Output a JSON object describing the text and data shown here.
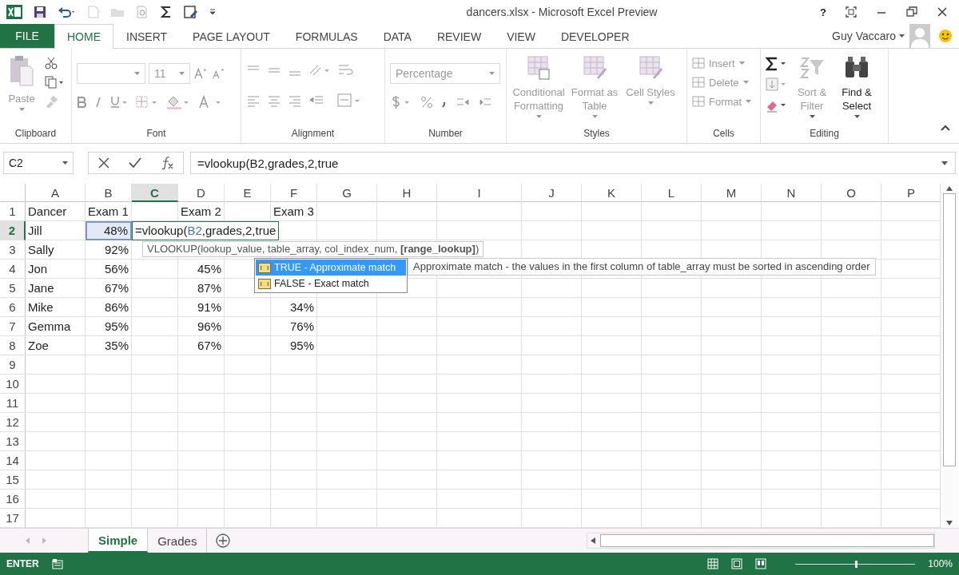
{
  "window": {
    "title": "dancers.xlsx - Microsoft Excel Preview",
    "controls": [
      "?"
    ]
  },
  "tabs": [
    {
      "label": "FILE",
      "kind": "file",
      "selected": false
    },
    {
      "label": "HOME",
      "kind": "tab",
      "selected": true
    },
    {
      "label": "INSERT",
      "kind": "tab",
      "selected": false
    },
    {
      "label": "PAGE LAYOUT",
      "kind": "tab",
      "selected": false
    },
    {
      "label": "FORMULAS",
      "kind": "tab",
      "selected": false
    },
    {
      "label": "DATA",
      "kind": "tab",
      "selected": false
    },
    {
      "label": "REVIEW",
      "kind": "tab",
      "selected": false
    },
    {
      "label": "VIEW",
      "kind": "tab",
      "selected": false
    },
    {
      "label": "DEVELOPER",
      "kind": "tab",
      "selected": false
    }
  ],
  "user": {
    "name": "Guy Vaccaro"
  },
  "ribbon": [
    {
      "kind": "clipboard",
      "label": "Clipboard",
      "items": [
        {
          "label": "Paste",
          "disabled": true
        }
      ]
    },
    {
      "kind": "font",
      "label": "Font",
      "items": [
        {
          "label": "11",
          "disabled": true
        }
      ]
    },
    {
      "kind": "alignment",
      "label": "Alignment"
    },
    {
      "kind": "number",
      "label": "Number",
      "items": [
        {
          "label": "Percentage",
          "disabled": true
        }
      ]
    },
    {
      "kind": "styles",
      "label": "Styles",
      "items": [
        {
          "label": "Conditional Formatting",
          "disabled": true
        },
        {
          "label": "Format as Table",
          "disabled": true
        },
        {
          "label": "Cell Styles",
          "disabled": true
        }
      ]
    },
    {
      "kind": "cells",
      "label": "Cells",
      "items": [
        {
          "label": "Insert",
          "disabled": true
        },
        {
          "label": "Delete",
          "disabled": true
        },
        {
          "label": "Format",
          "disabled": true
        }
      ]
    },
    {
      "kind": "editing",
      "label": "Editing",
      "items": [
        {
          "label": "Sort & Filter",
          "disabled": true
        },
        {
          "label": "Find & Select",
          "disabled": false
        }
      ]
    }
  ],
  "formula_bar": {
    "name_box": "C2",
    "formula": "=vlookup(B2,grades,2,true"
  },
  "columns": [
    {
      "label": "A",
      "selected": false
    },
    {
      "label": "B",
      "selected": false
    },
    {
      "label": "C",
      "selected": true
    },
    {
      "label": "D",
      "selected": false
    },
    {
      "label": "E",
      "selected": false
    },
    {
      "label": "F",
      "selected": false
    },
    {
      "label": "G",
      "selected": false
    },
    {
      "label": "H",
      "selected": false
    },
    {
      "label": "I",
      "selected": false
    },
    {
      "label": "J",
      "selected": false
    },
    {
      "label": "K",
      "selected": false
    },
    {
      "label": "L",
      "selected": false
    },
    {
      "label": "M",
      "selected": false
    },
    {
      "label": "N",
      "selected": false
    },
    {
      "label": "O",
      "selected": false
    },
    {
      "label": "P",
      "selected": false
    }
  ],
  "rows": [
    {
      "number": "1",
      "selected": false,
      "kind": "header",
      "cells": [
        "Dancer",
        "Exam 1",
        "",
        "Exam 2",
        "",
        "Exam 3"
      ]
    },
    {
      "number": "2",
      "selected": true,
      "kind": "data",
      "cells": [
        "Jill",
        "48%"
      ]
    },
    {
      "number": "3",
      "selected": false,
      "kind": "data",
      "cells": [
        "Sally",
        "92%"
      ]
    },
    {
      "number": "4",
      "selected": false,
      "kind": "data",
      "cells": [
        "Jon",
        "56%",
        "",
        "45%"
      ]
    },
    {
      "number": "5",
      "selected": false,
      "kind": "data",
      "cells": [
        "Jane",
        "67%",
        "",
        "87%"
      ]
    },
    {
      "number": "6",
      "selected": false,
      "kind": "data",
      "cells": [
        "Mike",
        "86%",
        "",
        "91%",
        "",
        "34%"
      ]
    },
    {
      "number": "7",
      "selected": false,
      "kind": "data",
      "cells": [
        "Gemma",
        "95%",
        "",
        "96%",
        "",
        "76%"
      ]
    },
    {
      "number": "8",
      "selected": false,
      "kind": "data",
      "cells": [
        "Zoe",
        "35%",
        "",
        "67%",
        "",
        "95%"
      ]
    },
    {
      "number": "9",
      "selected": false
    },
    {
      "number": "10",
      "selected": false
    },
    {
      "number": "11",
      "selected": false
    },
    {
      "number": "12",
      "selected": false
    },
    {
      "number": "13",
      "selected": false
    },
    {
      "number": "14",
      "selected": false
    },
    {
      "number": "15",
      "selected": false
    },
    {
      "number": "16",
      "selected": false
    },
    {
      "number": "17",
      "selected": false
    }
  ],
  "cell_editor": [
    {
      "text": "=vlookup(",
      "kind": "plain"
    },
    {
      "text": "B2",
      "kind": "ref"
    },
    {
      "text": ",grades,2,true",
      "kind": "plain"
    }
  ],
  "function_tooltip": "VLOOKUP(lookup_value, table_array, col_index_num, **[range_lookup]**)",
  "autocomplete": [
    {
      "label": "TRUE - Approximate match",
      "selected": true
    },
    {
      "label": "FALSE - Exact match",
      "selected": false
    }
  ],
  "description": "Approximate match - the values in the first column of table_array must be sorted in ascending order",
  "sheet_tabs": [
    {
      "label": "Simple",
      "selected": true
    },
    {
      "label": "Grades",
      "selected": false
    }
  ],
  "status_bar": {
    "mode": "ENTER",
    "zoom_slider": {
      "level": 0.5
    },
    "zoom": "100%"
  }
}
